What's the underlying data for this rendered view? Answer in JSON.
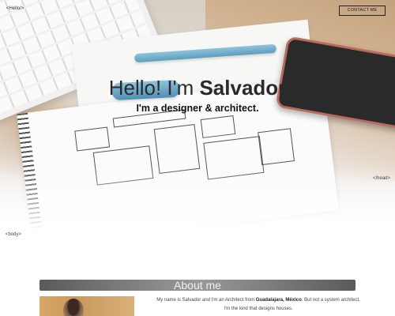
{
  "header": {
    "brand": "<Hello/>",
    "contact_label": "CONTACT ME"
  },
  "hero": {
    "greeting_prefix": "Hello! I'm ",
    "name": "Salvador",
    "tagline": "I'm a designer & architect.",
    "head_close_tag": "</head>",
    "body_open_tag": "<body>"
  },
  "about": {
    "title": "About me",
    "text_part1": "My name is Salvador and I'm an Architect from ",
    "location": "Guadalajara, México",
    "text_part2": ". But not a system architect, I'm the kind that designs houses."
  },
  "colors": {
    "pen_blue": "#5d9dbd",
    "about_bar": "#5a5a5a"
  }
}
